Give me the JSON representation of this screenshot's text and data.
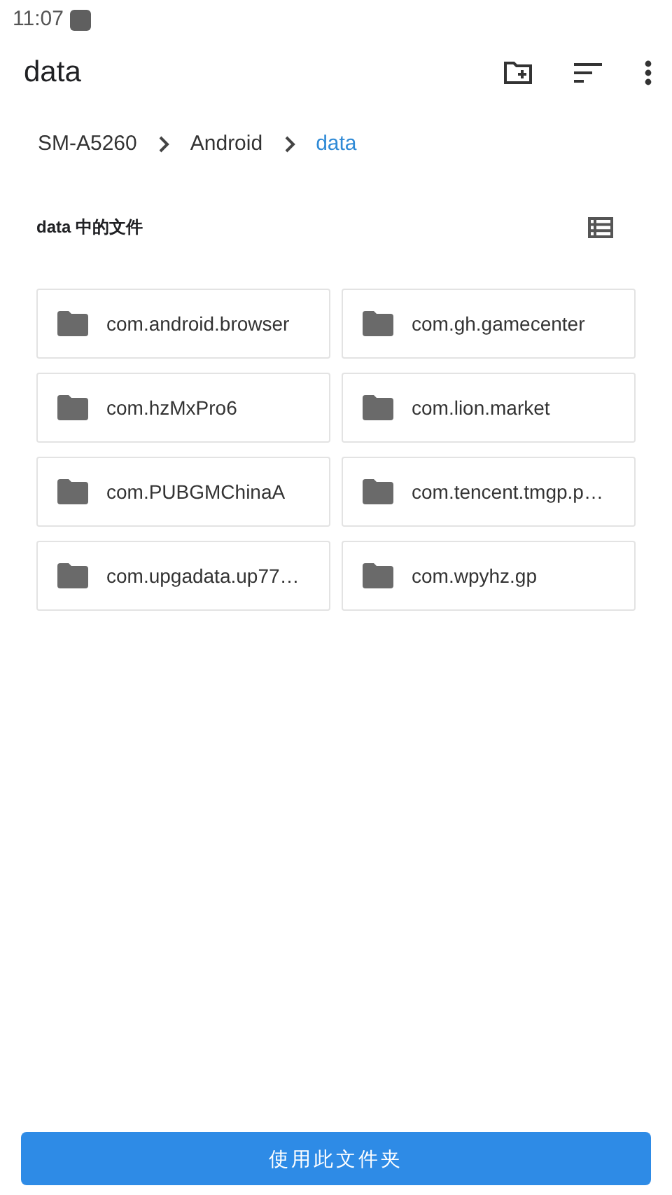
{
  "status_bar": {
    "time": "11:07"
  },
  "toolbar": {
    "title": "data"
  },
  "breadcrumbs": [
    {
      "label": "SM-A5260",
      "selected": false
    },
    {
      "label": "Android",
      "selected": false
    },
    {
      "label": "data",
      "selected": true
    }
  ],
  "section": {
    "title": "data 中的文件"
  },
  "folders": [
    {
      "name": "com.android.browser"
    },
    {
      "name": "com.gh.gamecenter"
    },
    {
      "name": "com.hzMxPro6"
    },
    {
      "name": "com.lion.market"
    },
    {
      "name": "com.PUBGMChinaA"
    },
    {
      "name": "com.tencent.tmgp.p…"
    },
    {
      "name": "com.upgadata.up77…"
    },
    {
      "name": "com.wpyhz.gp"
    }
  ],
  "action_button": {
    "label": "使用此文件夹"
  }
}
